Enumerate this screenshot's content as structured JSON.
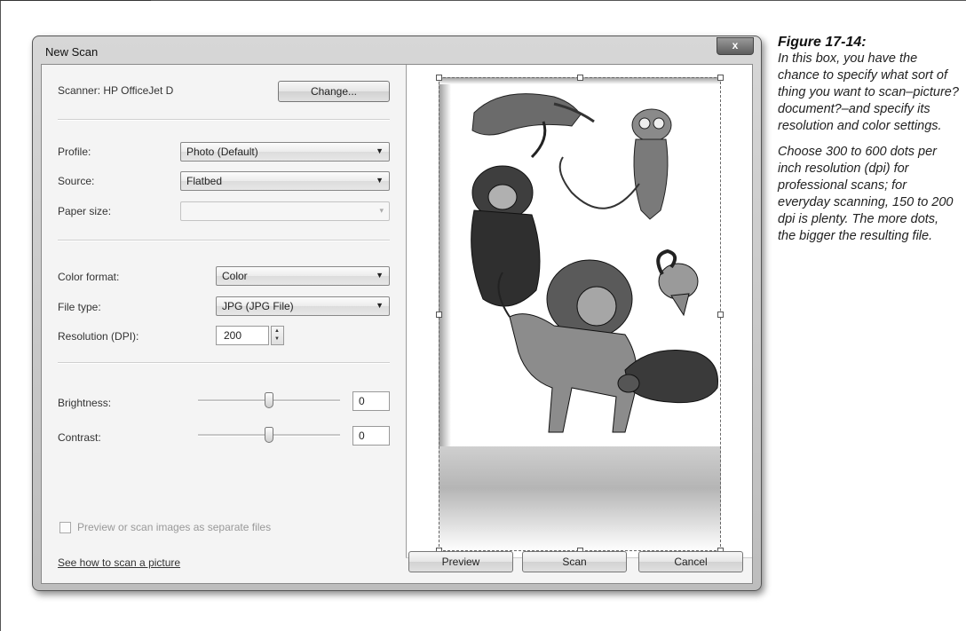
{
  "dialog": {
    "title": "New Scan",
    "close_label": "x"
  },
  "scanner": {
    "label": "Scanner: HP OfficeJet D",
    "change_button": "Change..."
  },
  "profile": {
    "label": "Profile:",
    "value": "Photo (Default)"
  },
  "source": {
    "label": "Source:",
    "value": "Flatbed"
  },
  "paper_size": {
    "label": "Paper size:",
    "value": ""
  },
  "color_format": {
    "label": "Color format:",
    "value": "Color"
  },
  "file_type": {
    "label": "File type:",
    "value": "JPG (JPG File)"
  },
  "resolution": {
    "label": "Resolution (DPI):",
    "value": "200"
  },
  "brightness": {
    "label": "Brightness:",
    "value": "0",
    "slider_level": 0.5
  },
  "contrast": {
    "label": "Contrast:",
    "value": "0",
    "slider_level": 0.5
  },
  "separate_files": {
    "label": "Preview or scan images as separate files",
    "checked": false
  },
  "help_link": "See how to scan a picture",
  "buttons": {
    "preview": "Preview",
    "scan": "Scan",
    "cancel": "Cancel"
  },
  "caption": {
    "title": "Figure 17-14:",
    "paragraph1": "In this box, you have the chance to specify what sort of thing you want to scan–picture? document?–and specify its resolution and color settings.",
    "paragraph2": "Choose 300 to 600 dots per inch resolution (dpi) for professional scans; for everyday scanning, 150 to 200 dpi is plenty. The more dots, the bigger the resulting file."
  }
}
